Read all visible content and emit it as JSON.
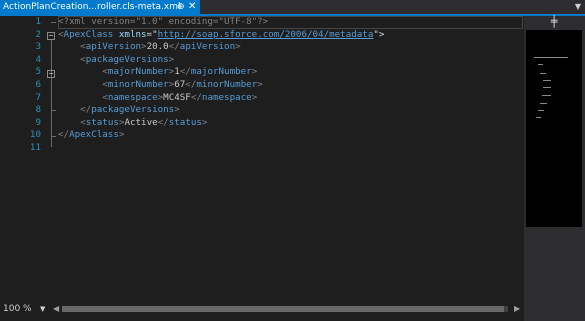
{
  "tab": {
    "title": "ActionPlanCreation...roller.cls-meta.xml",
    "pin_glyph": "⊕",
    "close_glyph": "✕",
    "dropdown_glyph": "▼"
  },
  "editor": {
    "line_numbers": [
      "1",
      "2",
      "3",
      "4",
      "5",
      "6",
      "7",
      "8",
      "9",
      "10",
      "11"
    ],
    "lines": {
      "l1": {
        "decl": "<?xml version=\"1.0\" encoding=\"UTF-8\"?>"
      },
      "l2": {
        "open": "<",
        "tag": "ApexClass",
        "attr": " xmlns",
        "eq": "=\"",
        "url": "http://soap.sforce.com/2006/04/metadata",
        "close": "\">"
      },
      "l3": {
        "indent": "    ",
        "tag": "apiVersion",
        "value": "20.0"
      },
      "l4": {
        "indent": "    ",
        "tag": "packageVersions"
      },
      "l5": {
        "indent": "        ",
        "tag": "majorNumber",
        "value": "1"
      },
      "l6": {
        "indent": "        ",
        "tag": "minorNumber",
        "value": "67"
      },
      "l7": {
        "indent": "        ",
        "tag": "namespace",
        "value": "MC4SF"
      },
      "l8": {
        "indent": "    ",
        "tag": "packageVersions"
      },
      "l9": {
        "indent": "    ",
        "tag": "status",
        "value": "Active"
      },
      "l10": {
        "tag": "ApexClass"
      }
    }
  },
  "statusbar": {
    "zoom": "100 %",
    "zoom_dropdown": "▼",
    "scroll_left": "◀",
    "scroll_right": "▶"
  },
  "map": {
    "split_glyph": "╪"
  },
  "colors": {
    "accent": "#007acc",
    "line_number": "#2b91af",
    "tag": "#569cd6",
    "attribute": "#9cdcfe",
    "bracket": "#808080"
  }
}
